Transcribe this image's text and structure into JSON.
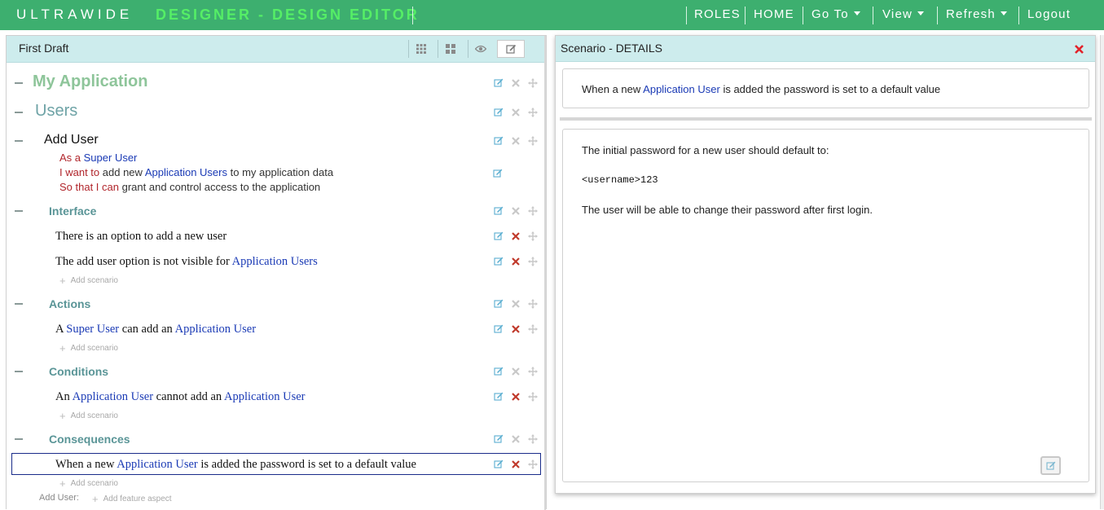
{
  "topbar": {
    "brand": "ULTRAWIDE",
    "subtitle": "DESIGNER - DESIGN EDITOR",
    "nav": {
      "roles": "ROLES",
      "home": "HOME",
      "goto": "Go To",
      "view": "View",
      "refresh": "Refresh",
      "logout": "Logout"
    }
  },
  "left_panel": {
    "title": "First Draft",
    "view_buttons": [
      "grid-small-icon",
      "grid-large-icon",
      "eye-icon",
      "edit-icon"
    ],
    "app": "My Application",
    "section": "Users",
    "feature": {
      "title": "Add User",
      "story": {
        "as_a": "As a",
        "role": "Super User",
        "i_want_to": "I want to",
        "want_pre": "add new",
        "want_entity": "Application Users",
        "want_post": "to my application data",
        "so_that": "So that I can",
        "benefit": "grant and control access to the application"
      }
    },
    "aspects": {
      "interface": {
        "title": "Interface",
        "s1": "There is an option to add a new user",
        "s2_pre": "The add user option is not visible for",
        "s2_entity": "Application Users"
      },
      "actions": {
        "title": "Actions",
        "s1_a": "A",
        "s1_role": "Super User",
        "s1_mid": "can add an",
        "s1_entity": "Application User"
      },
      "conditions": {
        "title": "Conditions",
        "s1_a": "An",
        "s1_entity1": "Application User",
        "s1_mid": "cannot add an",
        "s1_entity2": "Application User"
      },
      "consequences": {
        "title": "Consequences",
        "s1_pre": "When a new",
        "s1_entity": "Application User",
        "s1_post": "is added the password is set to a default value"
      }
    },
    "add_scenario": "Add scenario",
    "footer_label": "Add User:",
    "add_feature_aspect": "Add feature aspect"
  },
  "right_panel": {
    "title": "Scenario - DETAILS",
    "summary_pre": "When a new",
    "summary_entity": "Application User",
    "summary_post": "is added the password is set to a default value",
    "detail_line1": "The initial password for a new user should default to:",
    "detail_code": "<username>123",
    "detail_line2": "The user will be able to change their password after first login."
  },
  "colors": {
    "topbar": "#3daf6f",
    "subtitle": "#55ee66",
    "panel_header": "#cdeced",
    "entity": "#1a3ab5",
    "keyword": "#b1262c",
    "delete": "#c0392b"
  }
}
